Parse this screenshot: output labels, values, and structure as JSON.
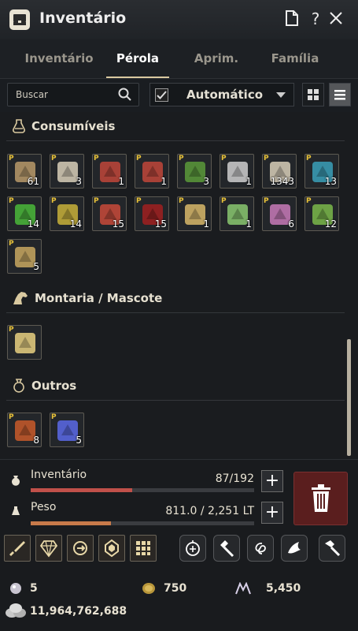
{
  "window": {
    "title": "Inventário"
  },
  "tabs": [
    {
      "label": "Inventário"
    },
    {
      "label": "Pérola"
    },
    {
      "label": "Aprim."
    },
    {
      "label": "Família"
    }
  ],
  "search": {
    "placeholder": "Buscar"
  },
  "sort": {
    "label": "Automático"
  },
  "sections": {
    "consumables": {
      "title": "Consumíveis"
    },
    "mount": {
      "title": "Montaria / Mascote"
    },
    "others": {
      "title": "Outros"
    }
  },
  "consumables": [
    {
      "icon": "map-scroll-icon",
      "badge": "P",
      "count": "61",
      "color": "#b89a6a"
    },
    {
      "icon": "scroll-icon",
      "badge": "P",
      "count": "3",
      "color": "#d8cfb8"
    },
    {
      "icon": "red-skull-elixir-icon",
      "badge": "P",
      "count": "1",
      "color": "#c0463a"
    },
    {
      "icon": "red-skull-elixir-icon",
      "badge": "P",
      "count": "1",
      "color": "#c0463a"
    },
    {
      "icon": "green-potion-icon",
      "badge": "P",
      "count": "3",
      "color": "#5b9a3a"
    },
    {
      "icon": "white-tree-icon",
      "badge": "P",
      "count": "1",
      "color": "#cfcfcf"
    },
    {
      "icon": "sealed-scroll-icon",
      "badge": "P",
      "count": "1343",
      "color": "#d8cfb8"
    },
    {
      "icon": "blue-vial-icon",
      "badge": "P",
      "count": "13",
      "color": "#3aa0b8"
    },
    {
      "icon": "green-vial-icon",
      "badge": "P",
      "count": "14",
      "color": "#4ab83a"
    },
    {
      "icon": "yellow-vial-icon",
      "badge": "P",
      "count": "14",
      "color": "#c8b23a"
    },
    {
      "icon": "red-vial-icon",
      "badge": "P",
      "count": "15",
      "color": "#c84a3a"
    },
    {
      "icon": "dark-red-vial-icon",
      "badge": "P",
      "count": "15",
      "color": "#a02020"
    },
    {
      "icon": "ticket-icon",
      "badge": "P",
      "count": "1",
      "color": "#d8b86a"
    },
    {
      "icon": "paw-ticket-icon",
      "badge": "P",
      "count": "1",
      "color": "#8ac870"
    },
    {
      "icon": "pink-perfume-icon",
      "badge": "P",
      "count": "6",
      "color": "#c87ab8"
    },
    {
      "icon": "green-perfume-icon",
      "badge": "P",
      "count": "12",
      "color": "#7ab84a"
    },
    {
      "icon": "gold-pouch-icon",
      "badge": "P",
      "count": "5",
      "color": "#c8a860"
    }
  ],
  "mount_items": [
    {
      "icon": "horn-icon",
      "badge": "P",
      "count": "",
      "color": "#e8d080"
    }
  ],
  "other_items": [
    {
      "icon": "red-book-icon",
      "badge": "P",
      "count": "8",
      "color": "#c85a2a"
    },
    {
      "icon": "blue-crystal-icon",
      "badge": "P",
      "count": "5",
      "color": "#5a6ae8"
    }
  ],
  "capacity": {
    "inventory_label": "Inventário",
    "inventory_value": "87/192",
    "inventory_fill": 0.453,
    "weight_label": "Peso",
    "weight_value": "811.0 / 2,251 LT",
    "weight_fill": 0.36
  },
  "currency": {
    "pearls": "5",
    "coins": "750",
    "points": "5,450",
    "silver": "11,964,762,688"
  },
  "colors": {
    "accent": "#d9c9a0",
    "inventory_bar": "#c0504a",
    "weight_bar": "#c87a4a",
    "trash": "#5a1e1e"
  }
}
